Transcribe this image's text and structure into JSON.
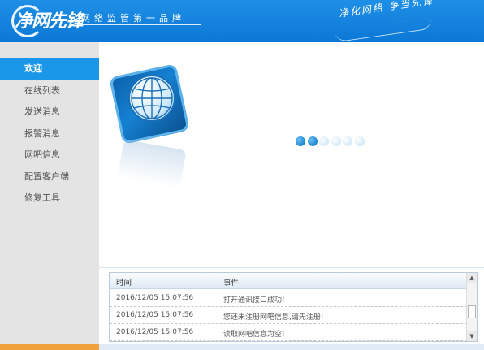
{
  "header": {
    "logo_text": "净网先锋",
    "slogan_left": "网络监管第一品牌",
    "slogan_right": "净化网络  争当先锋"
  },
  "sidebar": {
    "items": [
      {
        "label": "欢迎",
        "active": true
      },
      {
        "label": "在线列表",
        "active": false
      },
      {
        "label": "发送消息",
        "active": false
      },
      {
        "label": "报警消息",
        "active": false
      },
      {
        "label": "网吧信息",
        "active": false
      },
      {
        "label": "配置客户端",
        "active": false
      },
      {
        "label": "修复工具",
        "active": false
      }
    ]
  },
  "loader": {
    "total_dots": 6,
    "active_dots": 2
  },
  "log": {
    "columns": [
      "时间",
      "事件"
    ],
    "rows": [
      {
        "time": "2016/12/05 15:07:56",
        "event": "打开通讯接口成功!"
      },
      {
        "time": "2016/12/05 15:07:56",
        "event": "您还未注册网吧信息,请先注册!"
      },
      {
        "time": "2016/12/05 15:07:56",
        "event": "读取网吧信息为空!"
      }
    ]
  },
  "icons": {
    "globe": "globe-icon",
    "scroll_up": "scroll-up-icon",
    "scroll_down": "scroll-down-icon"
  },
  "colors": {
    "header_bg": "#0c78d6",
    "active_nav": "#1a97e8",
    "sidebar_bg": "#e4e4e4",
    "loader_on": "#1b86d3",
    "loader_off": "#cde6f8"
  }
}
